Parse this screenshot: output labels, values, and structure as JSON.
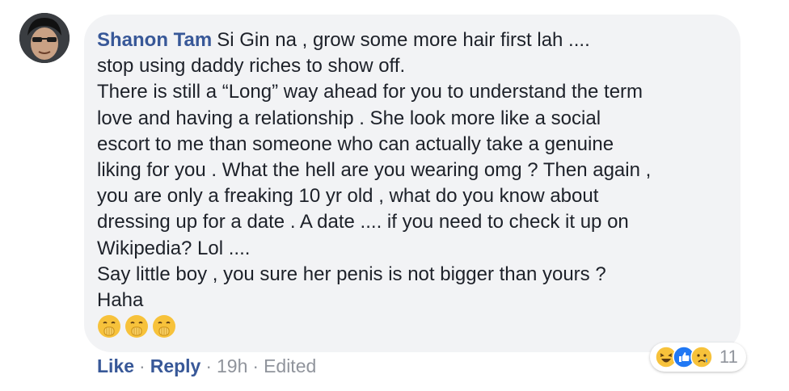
{
  "comment": {
    "author": "Shanon Tam",
    "first_line": "Si Gin na , grow some more hair first lah ....",
    "lines": [
      "stop using daddy riches to show off.",
      "There is still a “Long” way ahead for you to understand the term",
      "love and having a relationship . She look more like a social",
      "escort to me than someone who can actually take a genuine",
      "liking for you . What the hell are you wearing omg ? Then again ,",
      "you are only a freaking 10 yr old , what do you know about",
      "dressing up for a date . A date .... if you need to check it up on",
      "Wikipedia? Lol ....",
      "Say little boy , you sure her penis is not bigger than yours ?",
      "Haha"
    ],
    "emojis": [
      "hand-over-mouth-emoji",
      "hand-over-mouth-emoji",
      "hand-over-mouth-emoji"
    ]
  },
  "actions": {
    "like": "Like",
    "reply": "Reply",
    "time": "19h",
    "edited": "Edited",
    "separator": "·"
  },
  "reactions": {
    "icons": [
      "haha-reaction-icon",
      "like-reaction-icon",
      "sad-reaction-icon"
    ],
    "count": "11"
  },
  "colors": {
    "author": "#385898",
    "text": "#1d2129",
    "muted": "#90949c",
    "bubble": "#f2f3f5",
    "like_blue": "#2078f4",
    "emoji_yellow": "#f7c23b"
  }
}
